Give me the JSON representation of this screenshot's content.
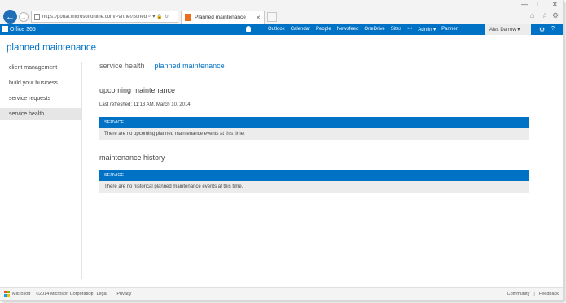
{
  "browser": {
    "url": "https://portal.microsoftonline.com/Partner/Schedu",
    "tab_title": "Planned maintenance",
    "back_label": "←",
    "forward_label": "→"
  },
  "suite_bar": {
    "brand": "Office 365",
    "nav": [
      "Outlook",
      "Calendar",
      "People",
      "Newsfeed",
      "OneDrive",
      "Sites",
      "•••",
      "Admin ▾",
      "Partner"
    ],
    "user": "Alex Darrow ▾",
    "gear": "⚙",
    "help": "?",
    "accent": "#0072c6"
  },
  "page": {
    "title": "planned maintenance"
  },
  "left_nav": {
    "items": [
      "client management",
      "build your business",
      "service requests",
      "service health"
    ],
    "selected_index": 3
  },
  "main": {
    "pivots": [
      "service health",
      "planned maintenance"
    ],
    "upcoming": {
      "heading": "upcoming maintenance",
      "last_refreshed": "Last refreshed: 11:13 AM, March 10, 2014",
      "column": "SERVICE",
      "message": "There are no upcoming planned maintenance events at this time."
    },
    "history": {
      "heading": "maintenance history",
      "column": "SERVICE",
      "message": "There are no historical planned maintenance events at this time."
    }
  },
  "footer": {
    "brand": "Microsoft",
    "copyright": "©2014 Microsoft Corporation",
    "links": [
      "Legal",
      "Privacy"
    ],
    "right_links": [
      "Community",
      "Feedback"
    ]
  }
}
